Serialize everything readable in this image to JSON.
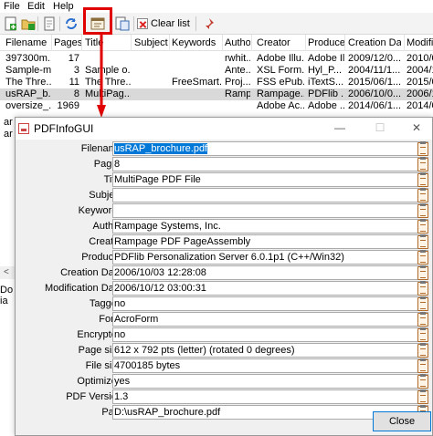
{
  "menu": [
    "File",
    "Edit",
    "Help"
  ],
  "toolbar": {
    "clear_label": "Clear list",
    "icons": [
      "add-file-icon",
      "add-folder-icon",
      "open-icon",
      "refresh-icon",
      "properties-icon",
      "export-icon",
      "clear-icon",
      "pin-icon"
    ]
  },
  "table": {
    "columns": [
      "Filename",
      "Pages",
      "Title",
      "Subject",
      "Keywords",
      "Author",
      "Creator",
      "Producer",
      "Creation Date",
      "Modification"
    ],
    "rows": [
      [
        "397300m...",
        "17",
        "",
        "",
        "",
        "rwhit...",
        "Adobe Illu...",
        "Adobe Illu...",
        "2009/12/0...",
        "2010/0"
      ],
      [
        "Sample-m...",
        "3",
        "Sample o...",
        "",
        "",
        "Ante...",
        "XSL Form...",
        "Hyl_P...",
        "2004/11/1...",
        "2004/1"
      ],
      [
        "The Thre...",
        "11",
        "The Thre...",
        "",
        "FreeSmart...",
        "Proj...",
        "FSS ePub...",
        "iTextS...",
        "2015/06/1...",
        "2015/0"
      ],
      [
        "usRAP_b...",
        "8",
        "MultiPag...",
        "",
        "",
        "Ramp...",
        "Rampage...",
        "PDFlib ...",
        "2006/10/0...",
        "2006/1"
      ],
      [
        "oversize_...",
        "1969",
        "",
        "",
        "",
        "",
        "Adobe Ac...",
        "Adobe ...",
        "2014/06/1...",
        "2014/0"
      ]
    ],
    "selected_row": 3
  },
  "background_fragments": {
    "row_frag_1": "ar",
    "row_frag_2": "ar",
    "status_frag_1": "Do",
    "status_frag_2": "ia",
    "scroll_arrow": "<"
  },
  "dialog": {
    "title": "PDFInfoGUI",
    "properties": [
      {
        "label": "Filename:",
        "value": "usRAP_brochure.pdf",
        "selected": true
      },
      {
        "label": "Pages:",
        "value": "8"
      },
      {
        "label": "Title:",
        "value": "MultiPage PDF File"
      },
      {
        "label": "Subject:",
        "value": ""
      },
      {
        "label": "Keywords:",
        "value": ""
      },
      {
        "label": "Author:",
        "value": "Rampage Systems, Inc."
      },
      {
        "label": "Creator:",
        "value": "Rampage PDF PageAssembly"
      },
      {
        "label": "Producer:",
        "value": "PDFlib Personalization Server 6.0.1p1 (C++/Win32)"
      },
      {
        "label": "Creation Date:",
        "value": "2006/10/03 12:28:08"
      },
      {
        "label": "Modification Date:",
        "value": "2006/10/12 03:00:31"
      },
      {
        "label": "Tagged:",
        "value": "no"
      },
      {
        "label": "Form:",
        "value": "AcroForm"
      },
      {
        "label": "Encrypted:",
        "value": "no"
      },
      {
        "label": "Page size:",
        "value": "612 x 792 pts (letter) (rotated 0 degrees)"
      },
      {
        "label": "File size:",
        "value": "4700185 bytes"
      },
      {
        "label": "Optimized:",
        "value": "yes"
      },
      {
        "label": "PDF Version:",
        "value": "1.3"
      },
      {
        "label": "Path:",
        "value": "D:\\usRAP_brochure.pdf"
      }
    ],
    "close_label": "Close"
  },
  "colors": {
    "highlight": "#e00000",
    "selection": "#0078d7",
    "selected_row": "#d9d9d9"
  }
}
